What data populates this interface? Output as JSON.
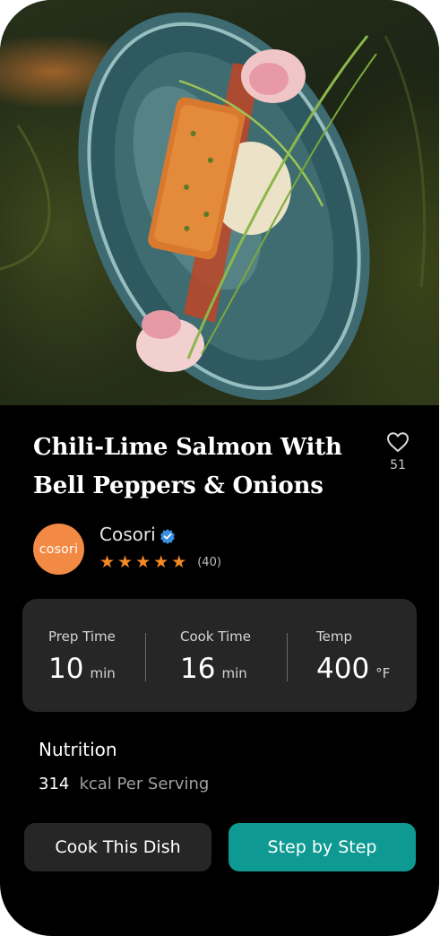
{
  "recipe": {
    "title_line1": "Chili-Lime Salmon With",
    "title_line2": "Bell Peppers & Onions",
    "favorite_count": "51"
  },
  "author": {
    "avatar_text": "cosori",
    "name": "Cosori",
    "verified": true,
    "rating": 5,
    "review_count": "(40)"
  },
  "stats": {
    "prep": {
      "label": "Prep Time",
      "value": "10",
      "unit": "min"
    },
    "cook": {
      "label": "Cook Time",
      "value": "16",
      "unit": "min"
    },
    "temp": {
      "label": "Temp",
      "value": "400",
      "unit": "°F"
    }
  },
  "nutrition": {
    "label": "Nutrition",
    "kcal_value": "314",
    "kcal_text": "kcal Per Serving"
  },
  "buttons": {
    "cook": "Cook This Dish",
    "step": "Step by Step"
  },
  "icons": {
    "favorite": "heart-outline-icon",
    "verified": "verified-badge-icon",
    "star": "star-filled-icon"
  },
  "colors": {
    "background": "#000000",
    "card": "#262626",
    "accent_teal": "#0e9a92",
    "star_orange": "#f38a26",
    "avatar_orange": "#f28a45",
    "verified_blue": "#3b8fe0"
  }
}
